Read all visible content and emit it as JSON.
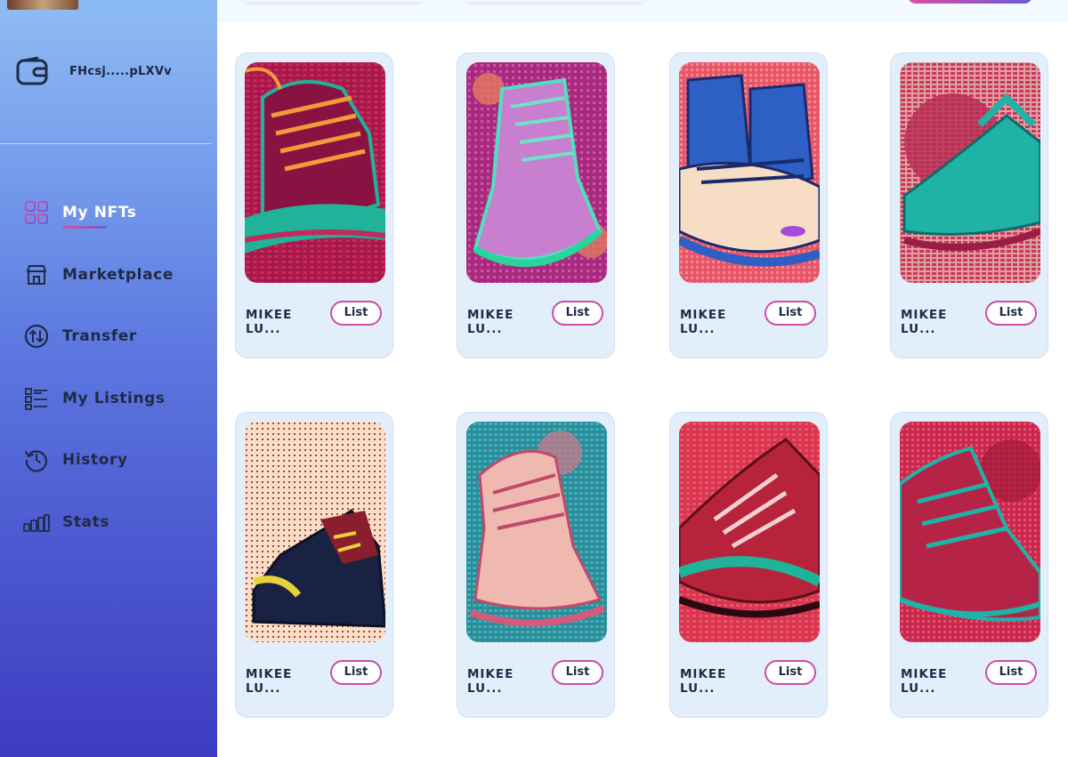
{
  "sidebar": {
    "wallet_address": "FHcsj.....pLXVv",
    "items": [
      {
        "label": "My NFTs",
        "icon": "grid-icon",
        "active": true
      },
      {
        "label": "Marketplace",
        "icon": "store-icon",
        "active": false
      },
      {
        "label": "Transfer",
        "icon": "transfer-icon",
        "active": false
      },
      {
        "label": "My Listings",
        "icon": "list-icon",
        "active": false
      },
      {
        "label": "History",
        "icon": "history-icon",
        "active": false
      },
      {
        "label": "Stats",
        "icon": "stats-icon",
        "active": false
      }
    ]
  },
  "nfts": [
    {
      "name": "MIKEE LU...",
      "action": "List"
    },
    {
      "name": "MIKEE LU...",
      "action": "List"
    },
    {
      "name": "MIKEE LU...",
      "action": "List"
    },
    {
      "name": "MIKEE LU...",
      "action": "List"
    },
    {
      "name": "MIKEE LU...",
      "action": "List"
    },
    {
      "name": "MIKEE LU...",
      "action": "List"
    },
    {
      "name": "MIKEE LU...",
      "action": "List"
    },
    {
      "name": "MIKEE LU...",
      "action": "List"
    }
  ],
  "colors": {
    "accent_start": "#d84ea3",
    "accent_end": "#6a5bd7",
    "sidebar_top": "#8fbcf2",
    "sidebar_bottom": "#3d3cc0"
  }
}
